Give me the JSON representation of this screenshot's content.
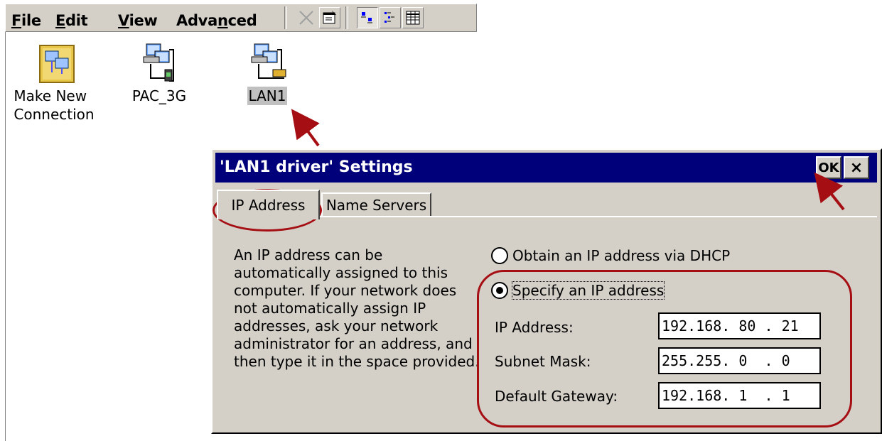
{
  "menu": {
    "file": "File",
    "edit": "Edit",
    "view": "View",
    "advanced": "Advanced"
  },
  "toolbar": {
    "buttons": [
      "delete-icon",
      "properties-icon",
      "large-icons-view-icon",
      "small-icons-view-icon",
      "details-view-icon"
    ]
  },
  "desktop": {
    "icons": [
      {
        "label_line1": "Make New",
        "label_line2": "Connection",
        "icon": "make-new-connection-icon"
      },
      {
        "label_line1": "PAC_3G",
        "icon": "network-connection-icon"
      },
      {
        "label_line1": "LAN1",
        "icon": "lan-connection-icon"
      }
    ]
  },
  "dialog": {
    "title": "'LAN1 driver' Settings",
    "ok_label": "OK",
    "close_label": "×",
    "tabs": [
      {
        "label": "IP Address",
        "active": true
      },
      {
        "label": "Name Servers",
        "active": false
      }
    ],
    "description": "An IP address can be automatically assigned to this computer.  If your network does not automatically assign IP addresses, ask your network administrator for an address, and then type it in the space provided.",
    "radio_dhcp": {
      "label": "Obtain an IP address via DHCP",
      "selected": false
    },
    "radio_specify": {
      "label": "Specify an IP address",
      "selected": true
    },
    "fields": {
      "ip_address_label": "IP Address:",
      "ip_address_value": "192.168. 80 . 21",
      "subnet_mask_label": "Subnet Mask:",
      "subnet_mask_value": "255.255. 0  . 0",
      "default_gateway_label": "Default Gateway:",
      "default_gateway_value": "192.168. 1  . 1"
    }
  },
  "colors": {
    "annotation": "#a50f14",
    "titlebar": "#00007b",
    "face": "#d4d0c8"
  }
}
